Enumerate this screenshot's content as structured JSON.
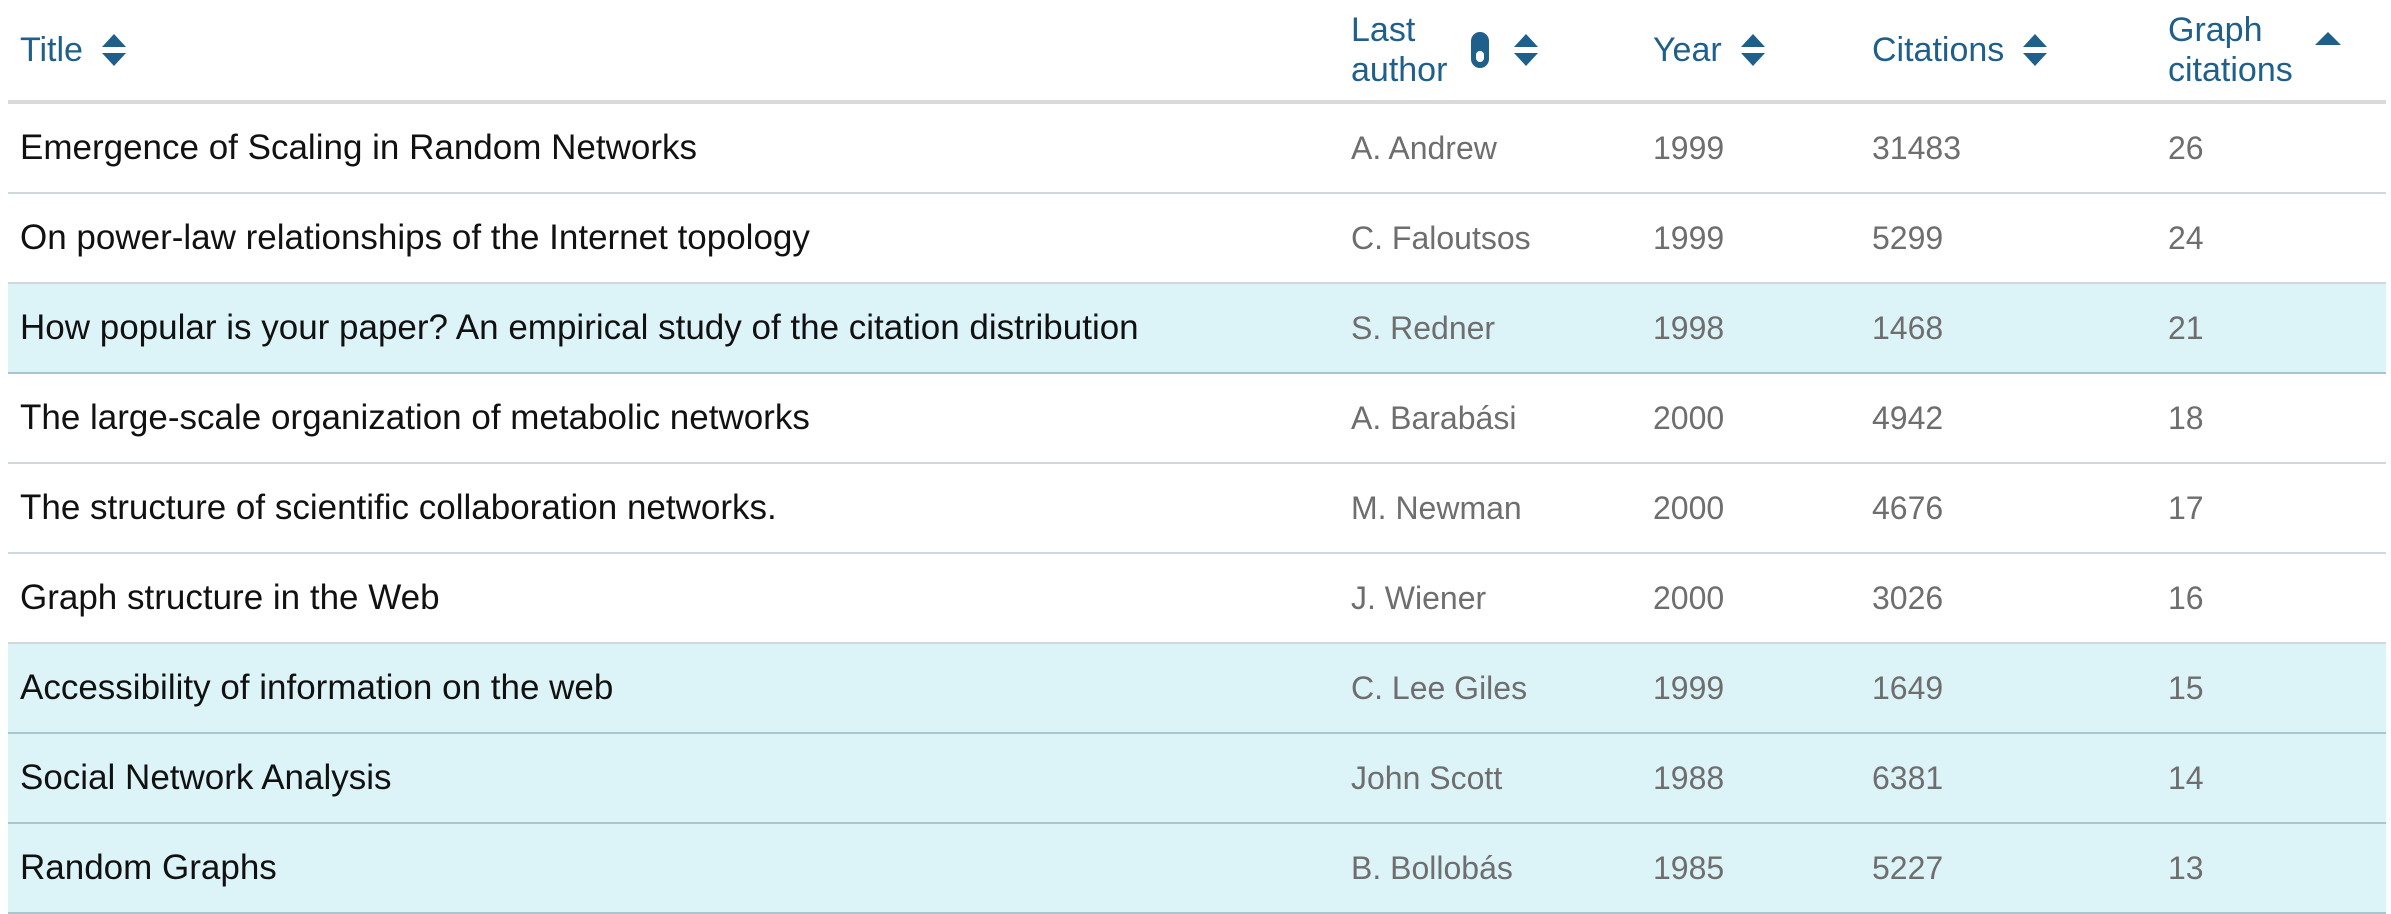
{
  "colors": {
    "header_text": "#1f5f8b",
    "highlight_row": "#dcf3f8",
    "title_text": "#111111",
    "meta_text": "#6e6e6e"
  },
  "columns": [
    {
      "key": "title",
      "label": "Title",
      "icon": "sort-both-icon"
    },
    {
      "key": "author",
      "label_line1": "Last",
      "label_line2": "author",
      "icons": [
        "filter-toggle-icon",
        "sort-both-icon"
      ]
    },
    {
      "key": "year",
      "label": "Year",
      "icon": "sort-both-icon"
    },
    {
      "key": "citations",
      "label": "Citations",
      "icon": "sort-both-icon"
    },
    {
      "key": "graph",
      "label_line1": "Graph",
      "label_line2": "citations",
      "icon": "sort-ascending-icon"
    }
  ],
  "rows": [
    {
      "title": "Emergence of Scaling in Random Networks",
      "author": "A. Andrew",
      "year": "1999",
      "citations": "31483",
      "graph": "26",
      "highlight": false
    },
    {
      "title": "On power-law relationships of the Internet topology",
      "author": "C. Faloutsos",
      "year": "1999",
      "citations": "5299",
      "graph": "24",
      "highlight": false
    },
    {
      "title": "How popular is your paper? An empirical study of the citation distribution",
      "author": "S. Redner",
      "year": "1998",
      "citations": "1468",
      "graph": "21",
      "highlight": true
    },
    {
      "title": "The large-scale organization of metabolic networks",
      "author": "A. Barabási",
      "year": "2000",
      "citations": "4942",
      "graph": "18",
      "highlight": false
    },
    {
      "title": "The structure of scientific collaboration networks.",
      "author": "M. Newman",
      "year": "2000",
      "citations": "4676",
      "graph": "17",
      "highlight": false
    },
    {
      "title": "Graph structure in the Web",
      "author": "J. Wiener",
      "year": "2000",
      "citations": "3026",
      "graph": "16",
      "highlight": false
    },
    {
      "title": "Accessibility of information on the web",
      "author": "C. Lee Giles",
      "year": "1999",
      "citations": "1649",
      "graph": "15",
      "highlight": true
    },
    {
      "title": "Social Network Analysis",
      "author": "John Scott",
      "year": "1988",
      "citations": "6381",
      "graph": "14",
      "highlight": true
    },
    {
      "title": "Random Graphs",
      "author": "B. Bollobás",
      "year": "1985",
      "citations": "5227",
      "graph": "13",
      "highlight": true
    }
  ]
}
